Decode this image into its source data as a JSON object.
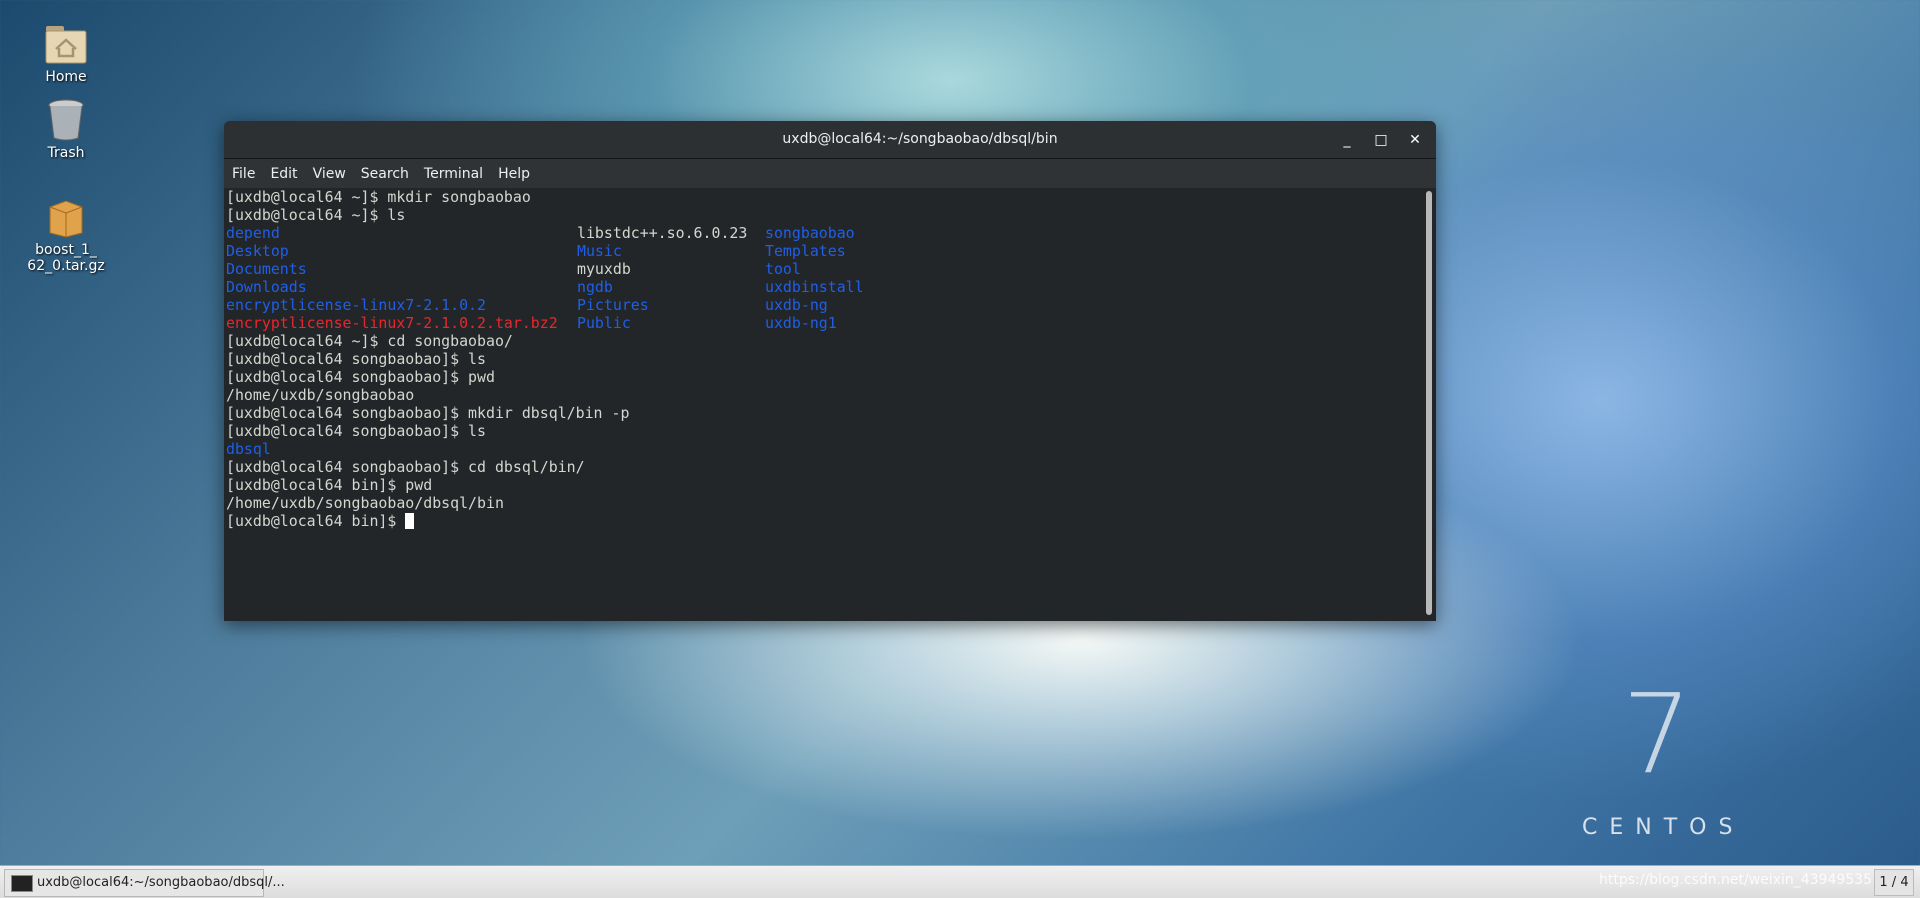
{
  "desktop": {
    "icons": [
      {
        "label": "Home"
      },
      {
        "label": "Trash"
      },
      {
        "label": "boost_1_62_0.tar.gz",
        "line1": "boost_1_",
        "line2": "62_0.tar.gz"
      }
    ]
  },
  "window": {
    "title": "uxdb@local64:~/songbaobao/dbsql/bin",
    "minimize": "_",
    "maximize": "□",
    "close": "✕"
  },
  "menu": [
    "File",
    "Edit",
    "View",
    "Search",
    "Terminal",
    "Help"
  ],
  "terminal": {
    "lines_before": [
      "[uxdb@local64 ~]$ mkdir songbaobao",
      "[uxdb@local64 ~]$ ls"
    ],
    "ls_rows": [
      [
        "depend",
        "libstdc++.so.6.0.23",
        "songbaobao"
      ],
      [
        "Desktop",
        "Music",
        "Templates"
      ],
      [
        "Documents",
        "myuxdb",
        "tool"
      ],
      [
        "Downloads",
        "ngdb",
        "uxdbinstall"
      ],
      [
        "encryptlicense-linux7-2.1.0.2",
        "Pictures",
        "uxdb-ng"
      ],
      [
        "encryptlicense-linux7-2.1.0.2.tar.bz2",
        "Public",
        "uxdb-ng1"
      ]
    ],
    "lines_after": [
      "[uxdb@local64 ~]$ cd songbaobao/",
      "[uxdb@local64 songbaobao]$ ls",
      "[uxdb@local64 songbaobao]$ pwd",
      "/home/uxdb/songbaobao",
      "[uxdb@local64 songbaobao]$ mkdir dbsql/bin -p",
      "[uxdb@local64 songbaobao]$ ls"
    ],
    "dir_line": "dbsql",
    "lines_end": [
      "[uxdb@local64 songbaobao]$ cd dbsql/bin/",
      "[uxdb@local64 bin]$ pwd",
      "/home/uxdb/songbaobao/dbsql/bin"
    ],
    "prompt": "[uxdb@local64 bin]$ "
  },
  "colors": {
    "directory": "#1f5fe8",
    "archive": "#e8262d",
    "text": "#d3d7cf"
  },
  "taskbar": {
    "task_label": "uxdb@local64:~/songbaobao/dbsql/...",
    "pager": "1 / 4",
    "watermark": "https://blog.csdn.net/weixin_43949535"
  },
  "branding": {
    "seven": "7",
    "word": "CENTOS"
  }
}
